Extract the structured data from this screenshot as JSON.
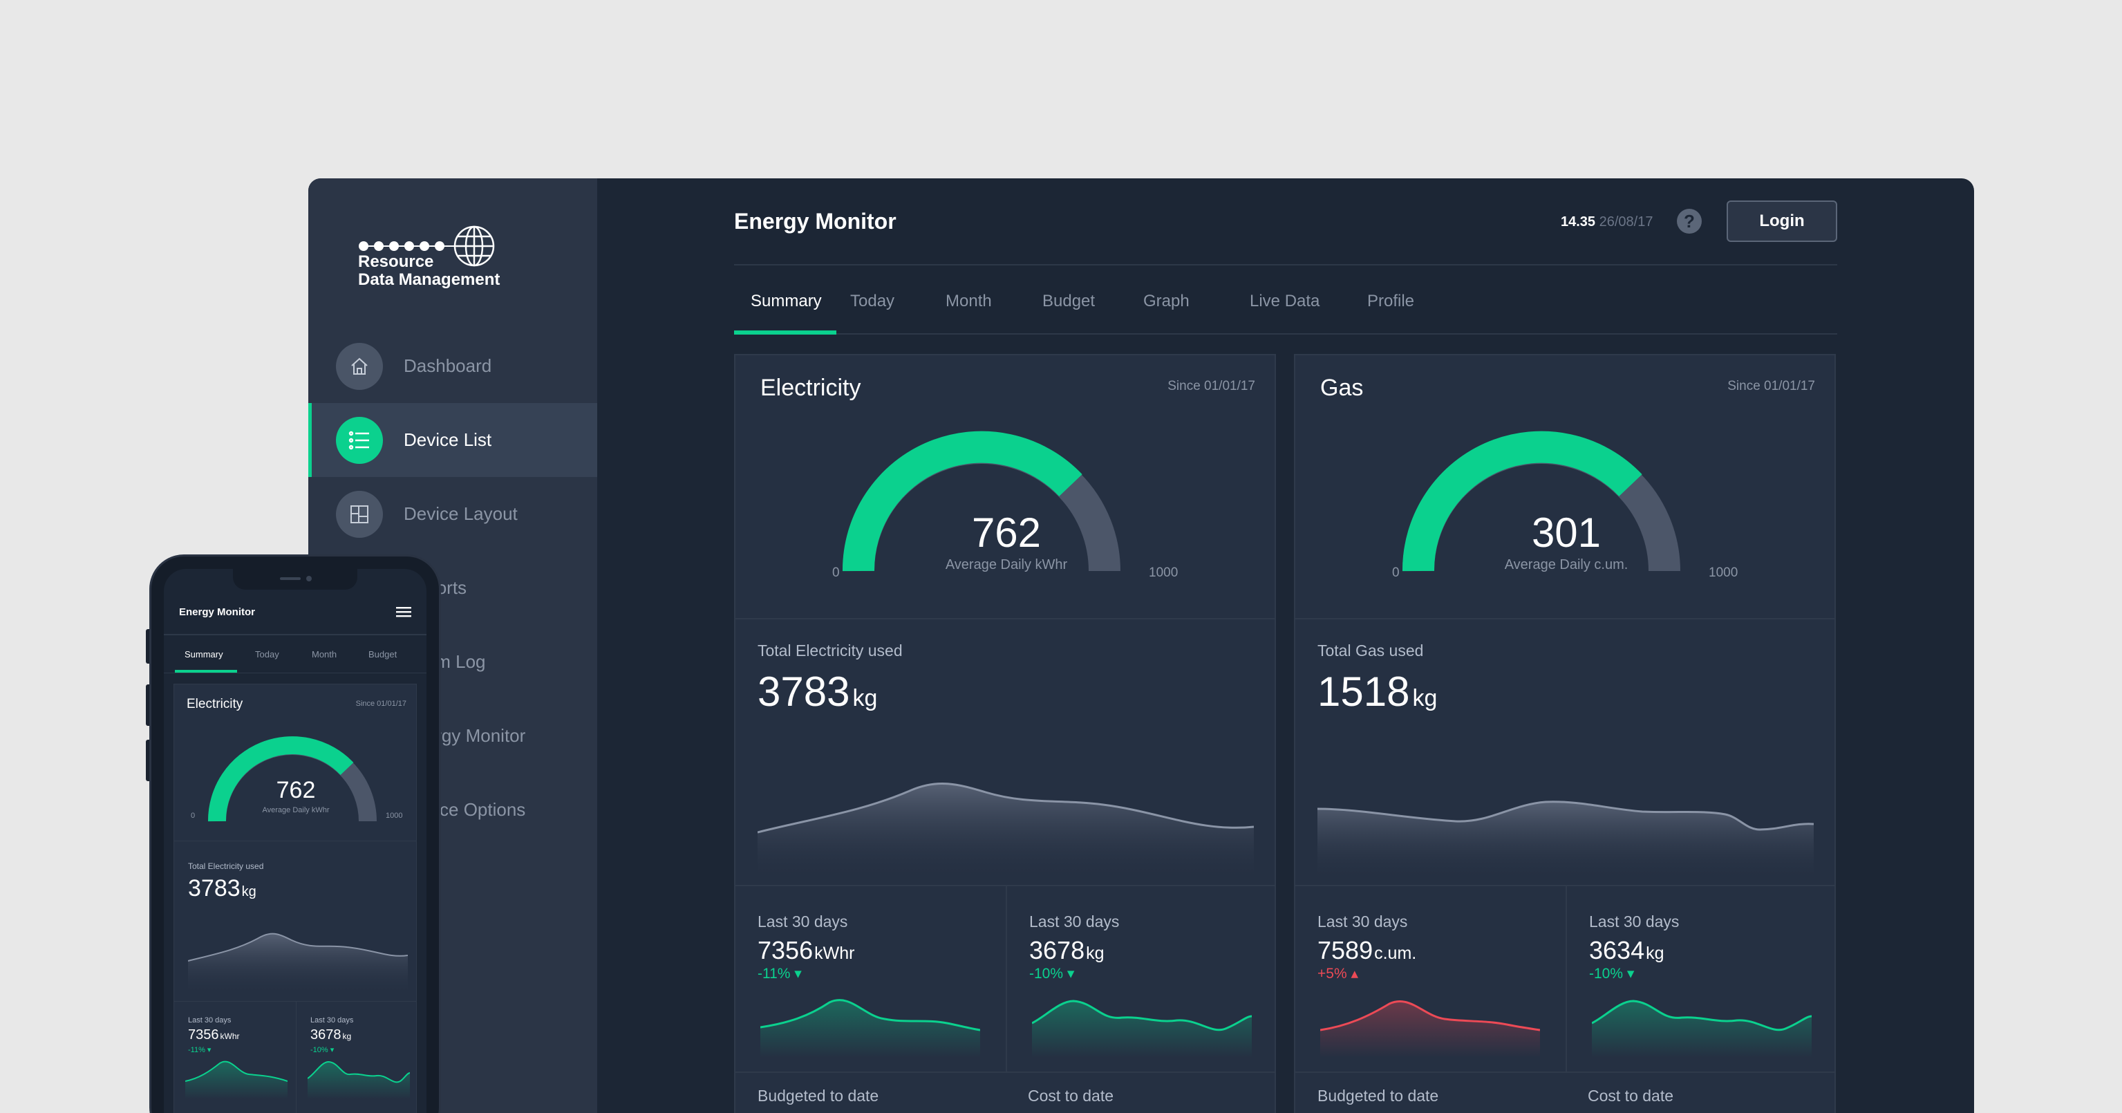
{
  "brand": {
    "name_line1": "Resource",
    "name_line2": "Data Management"
  },
  "colors": {
    "accent": "#0bd18e",
    "negative": "#ec4a56",
    "background": "#1c2635",
    "sidebar": "#2b3546",
    "card": "#253042"
  },
  "sidebar": {
    "items": [
      {
        "label": "Dashboard",
        "icon": "home-icon",
        "active": false
      },
      {
        "label": "Device List",
        "icon": "list-icon",
        "active": true
      },
      {
        "label": "Device Layout",
        "icon": "layout-icon",
        "active": false
      },
      {
        "label": "Reports",
        "icon": "reports-icon",
        "active": false
      },
      {
        "label": "Alarm Log",
        "icon": "alarm-icon",
        "active": false
      },
      {
        "label": "Energy Monitor",
        "icon": "energy-icon",
        "active": false
      },
      {
        "label": "Device Options",
        "icon": "options-icon",
        "active": false
      }
    ]
  },
  "header": {
    "title": "Energy Monitor",
    "time": "14.35",
    "date": "26/08/17",
    "help_icon": "question-icon",
    "login_label": "Login"
  },
  "tabs": [
    "Summary",
    "Today",
    "Month",
    "Budget",
    "Graph",
    "Live Data",
    "Profile"
  ],
  "cards": [
    {
      "title": "Electricity",
      "since": "Since 01/01/17",
      "gauge": {
        "value": "762",
        "label": "Average Daily kWhr",
        "min": "0",
        "max": "1000",
        "fraction": 0.762
      },
      "total_label": "Total Electricity used",
      "total_value": "3783",
      "total_unit": "kg",
      "subs": [
        {
          "label": "Last 30 days",
          "value": "7356",
          "unit": "kWhr",
          "change": "-11% ▾",
          "trend": "down"
        },
        {
          "label": "Last 30 days",
          "value": "3678",
          "unit": "kg",
          "change": "-10% ▾",
          "trend": "down"
        }
      ],
      "bottom": [
        "Budgeted to date",
        "Cost to date"
      ]
    },
    {
      "title": "Gas",
      "since": "Since 01/01/17",
      "gauge": {
        "value": "301",
        "label": "Average Daily c.um.",
        "min": "0",
        "max": "1000",
        "fraction": 0.762
      },
      "total_label": "Total Gas used",
      "total_value": "1518",
      "total_unit": "kg",
      "subs": [
        {
          "label": "Last 30 days",
          "value": "7589",
          "unit": "c.um.",
          "change": "+5% ▴",
          "trend": "up"
        },
        {
          "label": "Last 30 days",
          "value": "3634",
          "unit": "kg",
          "change": "-10% ▾",
          "trend": "down"
        }
      ],
      "bottom": [
        "Budgeted to date",
        "Cost to date"
      ]
    }
  ],
  "phone": {
    "title": "Energy Monitor",
    "menu_icon": "hamburger-menu-icon",
    "tabs": [
      "Summary",
      "Today",
      "Month",
      "Budget"
    ],
    "card": {
      "title": "Electricity",
      "since": "Since 01/01/17",
      "gauge": {
        "value": "762",
        "label": "Average Daily kWhr",
        "min": "0",
        "max": "1000"
      },
      "total_label": "Total Electricity used",
      "total_value": "3783",
      "total_unit": "kg",
      "subs": [
        {
          "label": "Last 30 days",
          "value": "7356",
          "unit": "kWhr",
          "change": "-11% ▾"
        },
        {
          "label": "Last 30 days",
          "value": "3678",
          "unit": "kg",
          "change": "-10% ▾"
        }
      ]
    }
  }
}
